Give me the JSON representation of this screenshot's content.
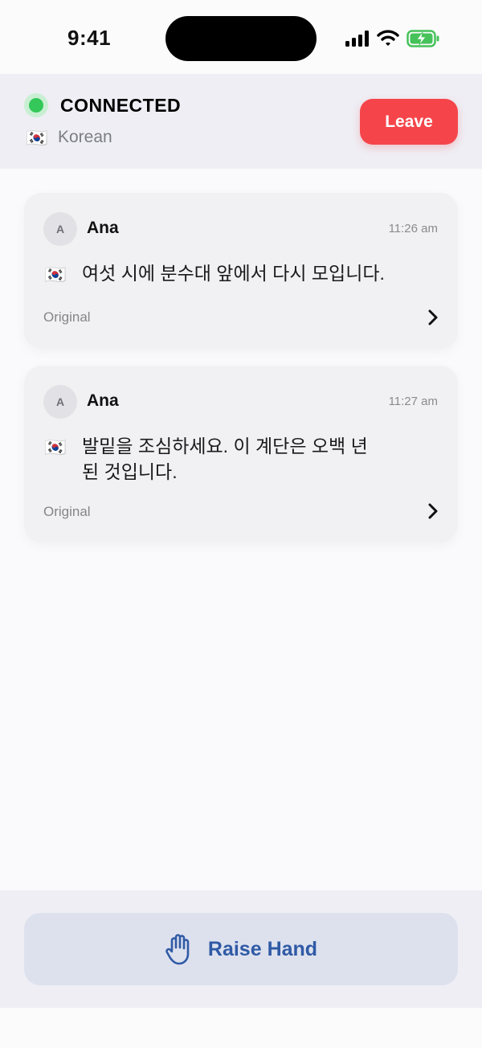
{
  "status_bar": {
    "time": "9:41"
  },
  "connection": {
    "status": "CONNECTED",
    "language_flag": "🇰🇷",
    "language": "Korean",
    "leave_label": "Leave"
  },
  "messages": [
    {
      "avatar": "A",
      "sender": "Ana",
      "time": "11:26 am",
      "flag": "🇰🇷",
      "text": "여섯 시에 분수대 앞에서 다시 모입니다.",
      "original_label": "Original"
    },
    {
      "avatar": "A",
      "sender": "Ana",
      "time": "11:27 am",
      "flag": "🇰🇷",
      "text": "발밑을 조심하세요. 이 계단은 오백 년 된 것입니다.",
      "original_label": "Original"
    }
  ],
  "bottom": {
    "raise_hand_label": "Raise Hand",
    "raise_hand_icon": "raised-hand-icon"
  },
  "colors": {
    "connected": "#34c759",
    "leave": "#f5454a",
    "accent": "#2f5aa5"
  }
}
